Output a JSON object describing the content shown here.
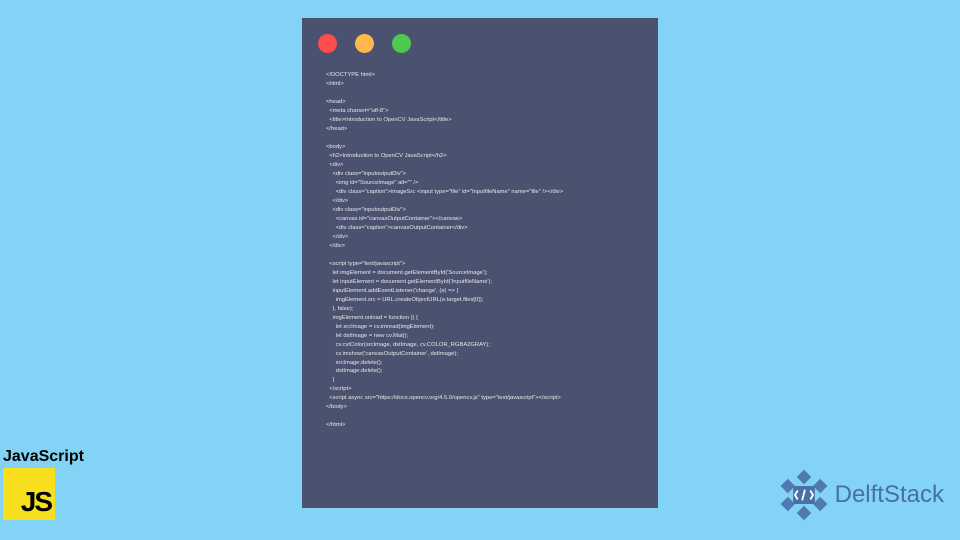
{
  "code": {
    "lines": [
      "<!DOCTYPE html>",
      "<html>",
      "",
      "<head>",
      "  <meta charset=\"utf-8\">",
      "  <title>Introduction to OpenCV JavaScript</title>",
      "</head>",
      "",
      "<body>",
      "  <h2>Introduction to OpenCV JavaScript</h2>",
      "  <div>",
      "    <div class=\"inputoutputDiv\">",
      "      <img id=\"SourceImage\" alt=\"\" />",
      "      <div class=\"caption\">imageSrc <input type=\"file\" id=\"InputfileName\" name=\"file\" /></div>",
      "    </div>",
      "    <div class=\"inputoutputDiv\">",
      "      <canvas id=\"canvasOutputContainer\"></canvas>",
      "      <div class=\"caption\">canvasOutputContainer</div>",
      "    </div>",
      "  </div>",
      "",
      "  <script type=\"text/javascript\">",
      "    let imgElement = document.getElementById('SourceImage');",
      "    let inputElement = document.getElementById('InputfileName');",
      "    inputElement.addEventListener('change', (e) => {",
      "      imgElement.src = URL.createObjectURL(e.target.files[0]);",
      "    }, false);",
      "    imgElement.onload = function () {",
      "      let srcImage = cv.imread(imgElement);",
      "      let dstImage = new cv.Mat();",
      "      cv.cvtColor(srcImage, dstImage, cv.COLOR_RGBA2GRAY);",
      "      cv.imshow('canvasOutputContainer', dstImage);",
      "      srcImage.delete();",
      "      dstImage.delete();",
      "    }",
      "  </script>",
      "  <script async src=\"https://docs.opencv.org/4.5.0/opencv.js\" type=\"text/javascript\"></script>",
      "</body>",
      "",
      "</html>"
    ]
  },
  "badges": {
    "js_label": "JavaScript",
    "js_logo_text": "JS",
    "delft_text": "DelftStack"
  },
  "traffic_lights": {
    "red": "#ff4d4d",
    "yellow": "#ffb84d",
    "green": "#4dc94d"
  }
}
